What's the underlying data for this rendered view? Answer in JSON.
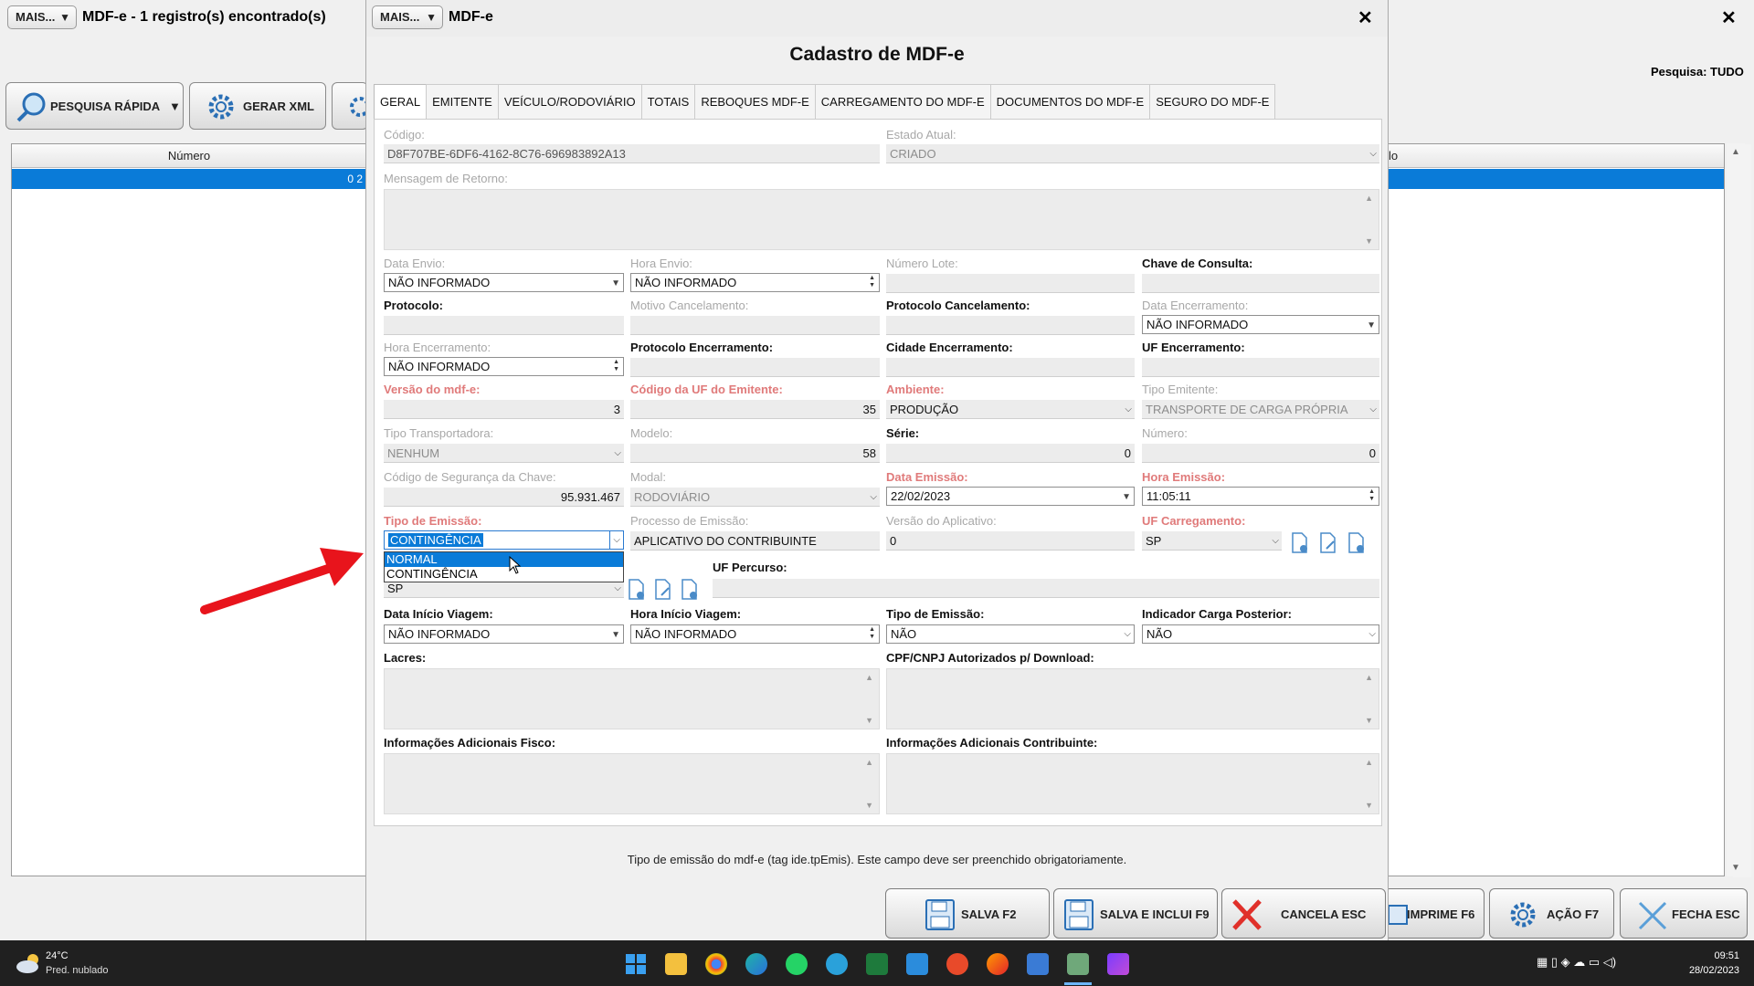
{
  "main_window": {
    "mais_label": "MAIS...",
    "title": "MDF-e - 1 registro(s) encontrado(s)",
    "search_status": "Pesquisa: TUDO",
    "btn_quick_search": "PESQUISA RÁPIDA",
    "btn_generate_xml": "GERAR XML",
    "grid_header": "Número",
    "grid_row_value": "0 2",
    "grid2_header": "lo"
  },
  "modal": {
    "mais_label": "MAIS...",
    "window_title": "MDF-e",
    "title": "Cadastro de MDF-e",
    "tabs": [
      "GERAL",
      "EMITENTE",
      "VEÍCULO/RODOVIÁRIO",
      "TOTAIS",
      "REBOQUES MDF-E",
      "CARREGAMENTO DO MDF-E",
      "DOCUMENTOS DO MDF-E",
      "SEGURO DO MDF-E"
    ],
    "fields": {
      "codigo_label": "Código:",
      "codigo_value": "D8F707BE-6DF6-4162-8C76-696983892A13",
      "estado_label": "Estado Atual:",
      "estado_value": "CRIADO",
      "mensagem_label": "Mensagem de Retorno:",
      "data_envio_label": "Data Envio:",
      "data_envio_value": "NÃO INFORMADO",
      "hora_envio_label": "Hora Envio:",
      "hora_envio_value": "NÃO INFORMADO",
      "numero_lote_label": "Número Lote:",
      "chave_label": "Chave de Consulta:",
      "protocolo_label": "Protocolo:",
      "motivo_canc_label": "Motivo Cancelamento:",
      "prot_canc_label": "Protocolo Cancelamento:",
      "data_enc_label": "Data Encerramento:",
      "data_enc_value": "NÃO INFORMADO",
      "hora_enc_label": "Hora Encerramento:",
      "hora_enc_value": "NÃO INFORMADO",
      "prot_enc_label": "Protocolo Encerramento:",
      "cidade_enc_label": "Cidade Encerramento:",
      "uf_enc_label": "UF Encerramento:",
      "versao_label": "Versão do mdf-e:",
      "versao_value": "3",
      "cod_uf_label": "Código da UF do Emitente:",
      "cod_uf_value": "35",
      "ambiente_label": "Ambiente:",
      "ambiente_value": "PRODUÇÃO",
      "tipo_emit_label": "Tipo Emitente:",
      "tipo_emit_value": "TRANSPORTE DE CARGA PRÓPRIA",
      "tipo_transp_label": "Tipo Transportadora:",
      "tipo_transp_value": "NENHUM",
      "modelo_label": "Modelo:",
      "modelo_value": "58",
      "serie_label": "Série:",
      "serie_value": "0",
      "numero_label": "Número:",
      "numero_value": "0",
      "cod_seg_label": "Código de Segurança da Chave:",
      "cod_seg_value": "95.931.467",
      "modal_label": "Modal:",
      "modal_value": "RODOVIÁRIO",
      "data_emis_label": "Data Emissão:",
      "data_emis_value": "22/02/2023",
      "hora_emis_label": "Hora Emissão:",
      "hora_emis_value": "11:05:11",
      "tipo_emis_label": "Tipo de Emissão:",
      "tipo_emis_value": "CONTINGÊNCIA",
      "processo_label": "Processo de Emissão:",
      "processo_value": "APLICATIVO DO CONTRIBUINTE",
      "versao_app_label": "Versão do Aplicativo:",
      "versao_app_value": "0",
      "uf_carreg_label": "UF Carregamento:",
      "uf_carreg_value": "SP",
      "uf_value_partial": "SP",
      "uf_percurso_label": "UF Percurso:",
      "data_ini_label": "Data Início Viagem:",
      "data_ini_value": "NÃO INFORMADO",
      "hora_ini_label": "Hora Início Viagem:",
      "hora_ini_value": "NÃO INFORMADO",
      "tipo_emis2_label": "Tipo de Emissão:",
      "tipo_emis2_value": "NÃO",
      "ind_carga_label": "Indicador Carga Posterior:",
      "ind_carga_value": "NÃO",
      "lacres_label": "Lacres:",
      "cpf_label": "CPF/CNPJ Autorizados p/ Download:",
      "info_fisco_label": "Informações Adicionais Fisco:",
      "info_contrib_label": "Informações Adicionais Contribuinte:"
    },
    "dropdown_options": [
      "NORMAL",
      "CONTINGÊNCIA"
    ],
    "hint": "Tipo de emissão do mdf-e (tag ide.tpEmis). Este campo deve ser preenchido obrigatoriamente.",
    "btn_save": "SALVA F2",
    "btn_save_include": "SALVA E INCLUI F9",
    "btn_cancel": "CANCELA ESC"
  },
  "bottom_buttons": {
    "print": "IMPRIME F6",
    "action": "AÇÃO F7",
    "close": "FECHA ESC"
  },
  "taskbar": {
    "temp": "24°C",
    "weather": "Pred. nublado",
    "time": "09:51",
    "date": "28/02/2023"
  },
  "colors": {
    "accent": "#0a7bd8",
    "required_label": "#e07a7a",
    "arrow": "#e8141c"
  }
}
